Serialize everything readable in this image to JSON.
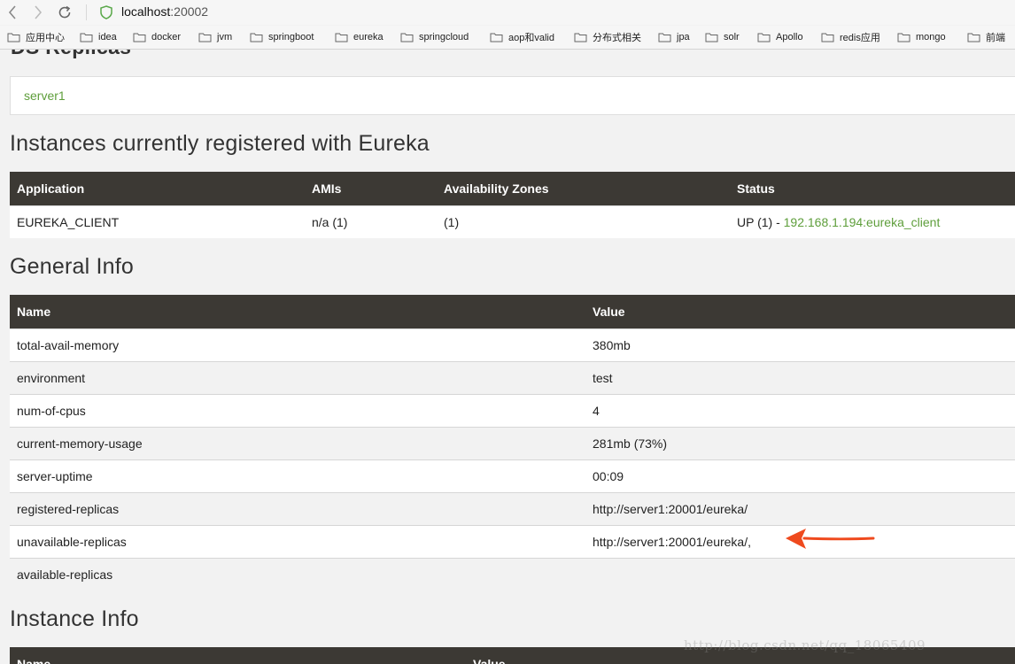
{
  "browser": {
    "url_host": "localhost",
    "url_port": ":20002",
    "bookmarks": [
      "应用中心",
      "idea",
      "docker",
      "jvm",
      "springboot",
      "eureka",
      "springcloud",
      "aop和valid",
      "分布式相关",
      "jpa",
      "solr",
      "Apollo",
      "redis应用",
      "mongo",
      "前端"
    ]
  },
  "ds_replicas": {
    "title": "DS Replicas",
    "server": "server1"
  },
  "instances": {
    "title": "Instances currently registered with Eureka",
    "headers": [
      "Application",
      "AMIs",
      "Availability Zones",
      "Status"
    ],
    "rows": [
      {
        "application": "EUREKA_CLIENT",
        "amis": "n/a (1)",
        "zones": "(1)",
        "status_prefix": "UP (1) - ",
        "status_link": "192.168.1.194:eureka_client"
      }
    ]
  },
  "general_info": {
    "title": "General Info",
    "headers": [
      "Name",
      "Value"
    ],
    "rows": [
      [
        "total-avail-memory",
        "380mb"
      ],
      [
        "environment",
        "test"
      ],
      [
        "num-of-cpus",
        "4"
      ],
      [
        "current-memory-usage",
        "281mb (73%)"
      ],
      [
        "server-uptime",
        "00:09"
      ],
      [
        "registered-replicas",
        "http://server1:20001/eureka/"
      ],
      [
        "unavailable-replicas",
        "http://server1:20001/eureka/,"
      ],
      [
        "available-replicas",
        ""
      ]
    ]
  },
  "instance_info": {
    "title": "Instance Info",
    "headers": [
      "Name",
      "Value"
    ]
  },
  "watermark": "http://blog.csdn.net/qq_18065409",
  "colors": {
    "accent_green": "#5e9e3b",
    "table_header": "#3c3934",
    "arrow": "#ef4a1e"
  }
}
